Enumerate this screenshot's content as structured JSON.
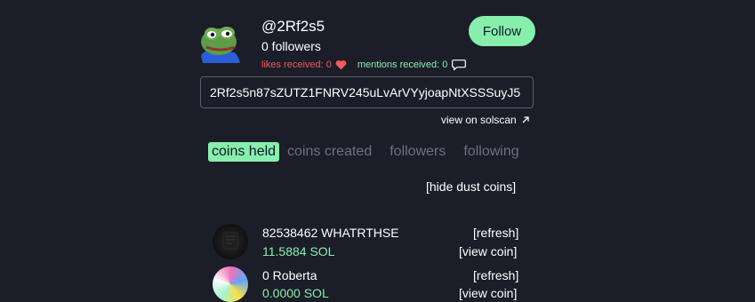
{
  "profile": {
    "username": "@2Rf2s5",
    "followers": "0 followers",
    "likes_received": "likes received: 0",
    "mentions_received": "mentions received: 0",
    "follow_label": "Follow",
    "address": "2Rf2s5n87sZUTZ1FNRV245uLvArVYyjoapNtXSSSuyJ5",
    "solscan_label": "view on solscan"
  },
  "tabs": [
    {
      "label": "coins held",
      "active": true
    },
    {
      "label": "coins created",
      "active": false
    },
    {
      "label": "followers",
      "active": false
    },
    {
      "label": "following",
      "active": false
    }
  ],
  "hide_dust_label": "[hide dust coins]",
  "coins": [
    {
      "name": "82538462 WHATRTHSE",
      "value": "11.5884 SOL",
      "refresh": "[refresh]",
      "view": "[view coin]"
    },
    {
      "name": "0 Roberta",
      "value": "0.0000 SOL",
      "refresh": "[refresh]",
      "view": "[view coin]"
    }
  ],
  "colors": {
    "background": "#1b1d28",
    "accent": "#86efac",
    "likes": "#f15b5b",
    "tab_inactive": "#6b7280"
  },
  "icons": {
    "likes": "heart-icon",
    "mentions": "chat-bubble-icon",
    "solscan": "arrow-up-right-icon"
  }
}
